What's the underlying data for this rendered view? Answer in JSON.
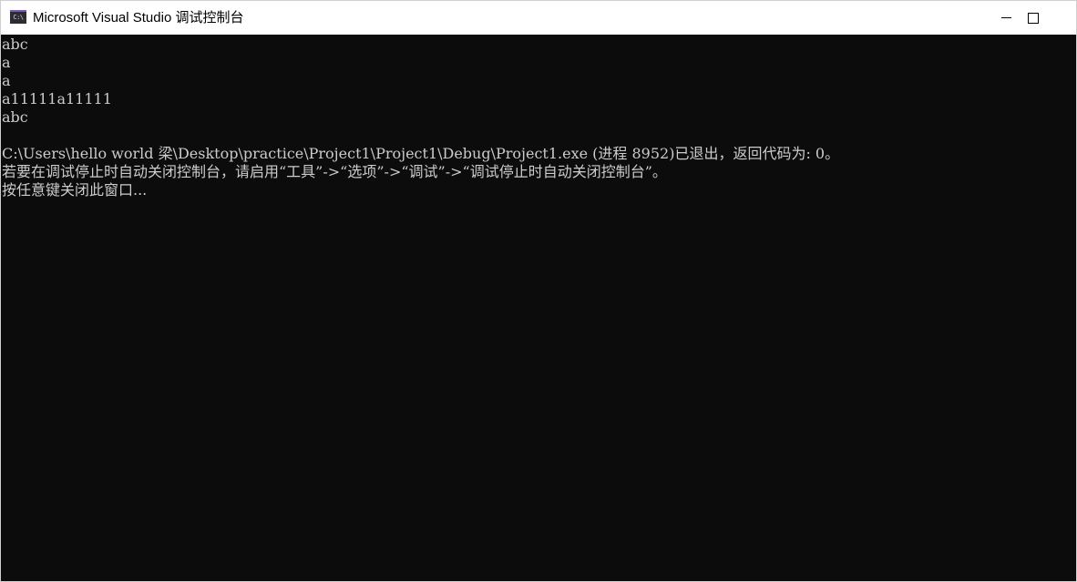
{
  "window": {
    "title": "Microsoft Visual Studio 调试控制台",
    "icon": "vs-console-icon",
    "icon_label": "C:\\"
  },
  "console": {
    "lines": [
      "abc",
      "a",
      "a",
      "a11111a11111",
      "abc",
      "",
      "C:\\Users\\hello world 梁\\Desktop\\practice\\Project1\\Project1\\Debug\\Project1.exe (进程 8952)已退出，返回代码为: 0。",
      "若要在调试停止时自动关闭控制台，请启用“工具”->“选项”->“调试”->“调试停止时自动关闭控制台”。",
      "按任意键关闭此窗口..."
    ]
  },
  "colors": {
    "console_bg": "#0c0c0c",
    "console_text": "#cccccc",
    "titlebar_bg": "#ffffff"
  }
}
